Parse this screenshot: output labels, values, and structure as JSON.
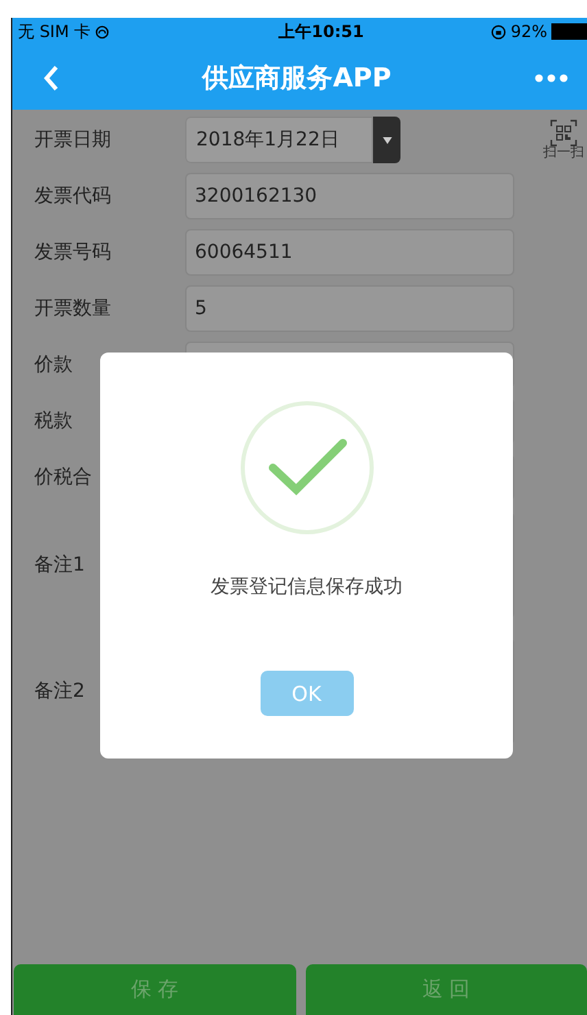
{
  "status_bar": {
    "carrier": "无 SIM 卡",
    "time": "上午10:51",
    "battery": "92%"
  },
  "nav": {
    "title": "供应商服务APP"
  },
  "form": {
    "fields": [
      {
        "kind": "date",
        "label": "开票日期",
        "value": "2018年1月22日"
      },
      {
        "kind": "text",
        "label": "发票代码",
        "value": "3200162130"
      },
      {
        "kind": "text",
        "label": "发票号码",
        "value": "60064511"
      },
      {
        "kind": "text",
        "label": "开票数量",
        "value": "5"
      },
      {
        "kind": "text",
        "label": "价款"
      },
      {
        "kind": "text",
        "label": "税款"
      },
      {
        "kind": "text",
        "label": "价税合"
      },
      {
        "kind": "textarea",
        "label": "备注1"
      },
      {
        "kind": "textarea",
        "label": "备注2"
      }
    ]
  },
  "scan": {
    "label": "扫一扫"
  },
  "dialog": {
    "message": "发票登记信息保存成功",
    "button": "OK"
  },
  "actions": [
    "保 存",
    "返 回"
  ]
}
